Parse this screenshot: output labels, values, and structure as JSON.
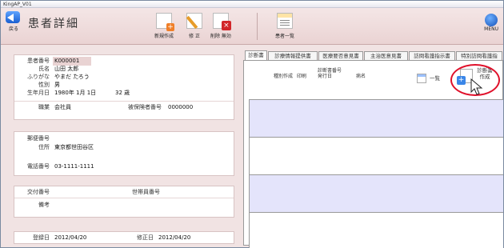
{
  "window": {
    "title": "KingAP_V01"
  },
  "header": {
    "title": "患者詳細",
    "back_label": "戻る",
    "menu_label": "MENU"
  },
  "toolbar": {
    "new_label": "新規作成",
    "edit_label": "修 正",
    "delete_label": "削除 無効",
    "list_label": "患者一覧"
  },
  "patient": {
    "id_label": "患者番号",
    "id": "K000001",
    "name_label": "氏名",
    "name": "山田 太郎",
    "kana_label": "ふりがな",
    "kana": "やまだ たろう",
    "sex_label": "性別",
    "sex": "男",
    "birth_label": "生年月日",
    "birth": "1980年 1月 1日",
    "age": "32 歳",
    "job_label": "職業",
    "job": "会社員",
    "insured_label": "被保険者番号",
    "insured": "0000000"
  },
  "address": {
    "zip_label": "郵便番号",
    "zip": "",
    "address_label": "住所",
    "address": "東京都世田谷区",
    "phone_label": "電話番号",
    "phone": "03-1111-1111"
  },
  "delivery": {
    "delivery_label": "交付番号",
    "delivery": "",
    "household_label": "世帯員番号",
    "household": "",
    "note_label": "備考",
    "note": ""
  },
  "dates": {
    "registered_label": "登録日",
    "registered": "2012/04/20",
    "modified_label": "修正日",
    "modified": "2012/04/20"
  },
  "tabs": [
    {
      "label": "診断書"
    },
    {
      "label": "診療情報提供書"
    },
    {
      "label": "医療要否意見書"
    },
    {
      "label": "主治医意見書"
    },
    {
      "label": "訪問看護指示書"
    },
    {
      "label": "特別訪問看護指"
    }
  ],
  "diagnosis": {
    "col_type": "種別",
    "col_create": "作成",
    "col_print": "印刷",
    "col_number": "診断書番号",
    "col_issued": "発行日",
    "col_disease": "病名",
    "list_label": "一覧",
    "create_label": "診断書作成"
  }
}
